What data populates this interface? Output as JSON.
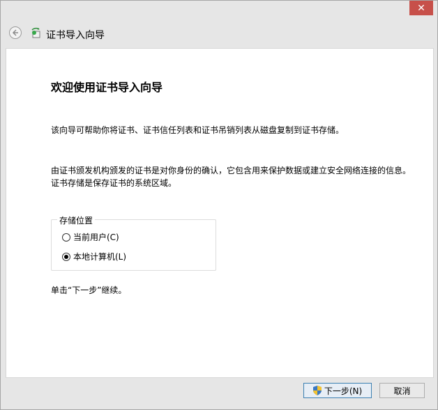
{
  "window": {
    "close_glyph": "✕",
    "title": "证书导入向导"
  },
  "content": {
    "heading": "欢迎使用证书导入向导",
    "para1": "该向导可帮助你将证书、证书信任列表和证书吊销列表从磁盘复制到证书存储。",
    "para2": "由证书颁发机构颁发的证书是对你身份的确认，它包含用来保护数据或建立安全网络连接的信息。证书存储是保存证书的系统区域。",
    "store_group": {
      "legend": "存储位置",
      "options": [
        {
          "label": "当前用户(C)",
          "checked": false
        },
        {
          "label": "本地计算机(L)",
          "checked": true
        }
      ]
    },
    "hint": "单击“下一步”继续。"
  },
  "footer": {
    "next_label": "下一步(N)",
    "cancel_label": "取消"
  },
  "colors": {
    "close_button": "#c7504a",
    "next_border": "#3c7fb1",
    "content_bg": "#ffffff",
    "chrome_bg": "#e6e6e6"
  },
  "icons": {
    "back": "back-arrow-icon",
    "wizard": "certificate-wizard-icon",
    "shield": "uac-shield-icon"
  }
}
